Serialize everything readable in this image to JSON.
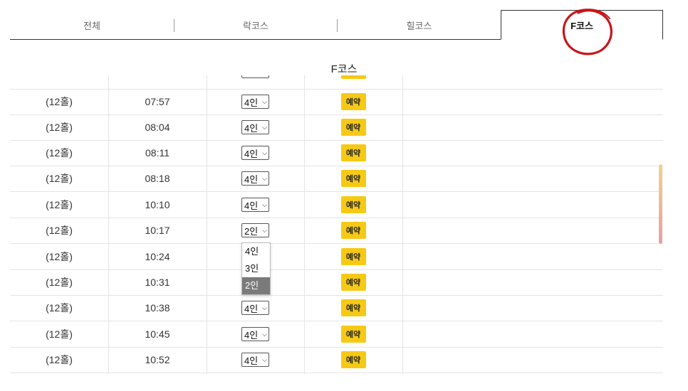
{
  "tabs": [
    {
      "label": "전체"
    },
    {
      "label": "락코스"
    },
    {
      "label": "힐코스"
    },
    {
      "label": "F코스",
      "active": true
    }
  ],
  "section_title": "F코스",
  "top_partial_select": "4인",
  "top_partial_button": "예약",
  "rows": [
    {
      "holes": "(12홀)",
      "time": "07:57",
      "people": "4인",
      "button": "예약"
    },
    {
      "holes": "(12홀)",
      "time": "08:04",
      "people": "4인",
      "button": "예약"
    },
    {
      "holes": "(12홀)",
      "time": "08:11",
      "people": "4인",
      "button": "예약"
    },
    {
      "holes": "(12홀)",
      "time": "08:18",
      "people": "4인",
      "button": "예약"
    },
    {
      "holes": "(12홀)",
      "time": "10:10",
      "people": "4인",
      "button": "예약"
    },
    {
      "holes": "(12홀)",
      "time": "10:17",
      "people": "2인",
      "button": "예약"
    },
    {
      "holes": "(12홀)",
      "time": "10:24",
      "people": "",
      "button": "예약"
    },
    {
      "holes": "(12홀)",
      "time": "10:31",
      "people": "",
      "button": "예약"
    },
    {
      "holes": "(12홀)",
      "time": "10:38",
      "people": "4인",
      "button": "예약"
    },
    {
      "holes": "(12홀)",
      "time": "10:45",
      "people": "4인",
      "button": "예약"
    },
    {
      "holes": "(12홀)",
      "time": "10:52",
      "people": "4인",
      "button": "예약"
    }
  ],
  "dropdown": {
    "options": [
      "4인",
      "3인",
      "2인"
    ],
    "selected": "2인"
  },
  "colors": {
    "reserve_button": "#f6c915",
    "annotation_circle": "#c8151b",
    "selected_option": "#7a7a7a"
  }
}
